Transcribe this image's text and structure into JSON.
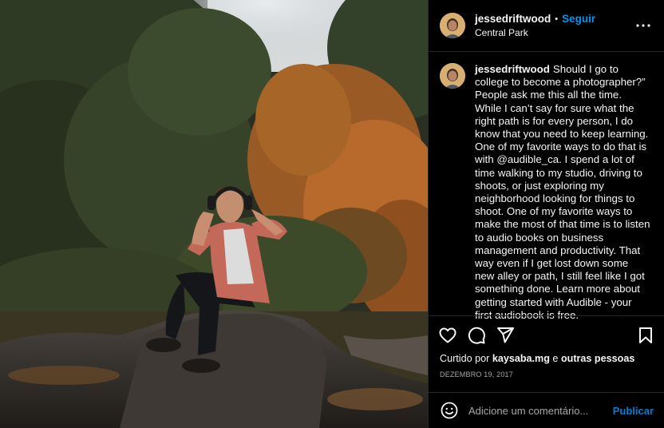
{
  "post": {
    "username": "jessedriftwood",
    "dot": "•",
    "follow_label": "Seguir",
    "location": "Central Park",
    "caption": "Should I go to college to become a photographer?” People ask me this all the time. While I can’t say for sure what the right path is for every person, I do know that you need to keep learning. One of my favorite ways to do that is with @audible_ca. I spend a lot of time walking to my studio, driving to shoots, or just exploring my neighborhood looking for things to shoot. One of my favorite ways to make the most of that time is to listen to audio books on business management and productivity. That way even if I get lost down some new alley or path, I still feel like I got something done. Learn more about getting started with Audible - your first audiobook is free.",
    "likes_prefix": "Curtido por",
    "likes_user": "kaysaba.mg",
    "likes_joiner": "e",
    "likes_others": "outras pessoas",
    "date": "DEZEMBRO 19, 2017"
  },
  "comment": {
    "placeholder": "Adicione um comentário...",
    "publish_label": "Publicar"
  },
  "icons": {
    "more": "more-options-icon",
    "like": "heart-icon",
    "comment": "comment-icon",
    "share": "share-icon",
    "save": "bookmark-icon",
    "emoji": "emoji-icon"
  },
  "colors": {
    "accent": "#0095f6",
    "background": "#000000",
    "divider": "#262626",
    "secondary_text": "#a8a8a8"
  }
}
